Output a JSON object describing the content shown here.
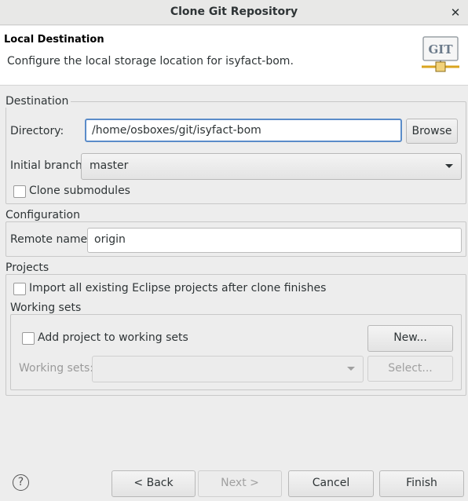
{
  "window": {
    "title": "Clone Git Repository",
    "close_glyph": "✕"
  },
  "banner": {
    "heading": "Local Destination",
    "description": "Configure the local storage location for isyfact-bom.",
    "logo_text": "GIT",
    "logo_icon": "git-logo-icon"
  },
  "destination": {
    "group_label": "Destination",
    "directory_label": "Directory:",
    "directory_value": "/home/osboxes/git/isyfact-bom",
    "browse_label": "Browse",
    "branch_label": "Initial branch:",
    "branch_value": "master",
    "submodules_label": "Clone submodules",
    "submodules_checked": false
  },
  "configuration": {
    "group_label": "Configuration",
    "remote_label": "Remote name:",
    "remote_value": "origin"
  },
  "projects": {
    "group_label": "Projects",
    "import_label": "Import all existing Eclipse projects after clone finishes",
    "import_checked": false,
    "working_sets": {
      "group_label": "Working sets",
      "add_label": "Add project to working sets",
      "add_checked": false,
      "new_label": "New...",
      "sets_label": "Working sets:",
      "sets_value": "",
      "select_label": "Select..."
    }
  },
  "footer": {
    "help_glyph": "?",
    "back_label": "< Back",
    "next_label": "Next >",
    "cancel_label": "Cancel",
    "finish_label": "Finish"
  }
}
